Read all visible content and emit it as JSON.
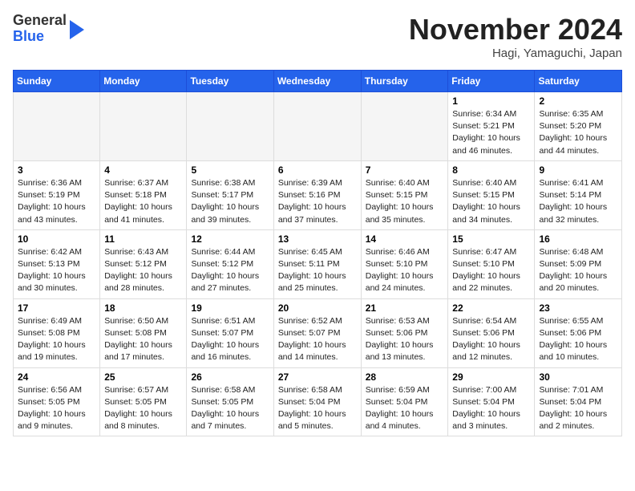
{
  "header": {
    "logo_line1": "General",
    "logo_line2": "Blue",
    "month": "November 2024",
    "location": "Hagi, Yamaguchi, Japan"
  },
  "weekdays": [
    "Sunday",
    "Monday",
    "Tuesday",
    "Wednesday",
    "Thursday",
    "Friday",
    "Saturday"
  ],
  "weeks": [
    [
      {
        "day": "",
        "info": ""
      },
      {
        "day": "",
        "info": ""
      },
      {
        "day": "",
        "info": ""
      },
      {
        "day": "",
        "info": ""
      },
      {
        "day": "",
        "info": ""
      },
      {
        "day": "1",
        "info": "Sunrise: 6:34 AM\nSunset: 5:21 PM\nDaylight: 10 hours\nand 46 minutes."
      },
      {
        "day": "2",
        "info": "Sunrise: 6:35 AM\nSunset: 5:20 PM\nDaylight: 10 hours\nand 44 minutes."
      }
    ],
    [
      {
        "day": "3",
        "info": "Sunrise: 6:36 AM\nSunset: 5:19 PM\nDaylight: 10 hours\nand 43 minutes."
      },
      {
        "day": "4",
        "info": "Sunrise: 6:37 AM\nSunset: 5:18 PM\nDaylight: 10 hours\nand 41 minutes."
      },
      {
        "day": "5",
        "info": "Sunrise: 6:38 AM\nSunset: 5:17 PM\nDaylight: 10 hours\nand 39 minutes."
      },
      {
        "day": "6",
        "info": "Sunrise: 6:39 AM\nSunset: 5:16 PM\nDaylight: 10 hours\nand 37 minutes."
      },
      {
        "day": "7",
        "info": "Sunrise: 6:40 AM\nSunset: 5:15 PM\nDaylight: 10 hours\nand 35 minutes."
      },
      {
        "day": "8",
        "info": "Sunrise: 6:40 AM\nSunset: 5:15 PM\nDaylight: 10 hours\nand 34 minutes."
      },
      {
        "day": "9",
        "info": "Sunrise: 6:41 AM\nSunset: 5:14 PM\nDaylight: 10 hours\nand 32 minutes."
      }
    ],
    [
      {
        "day": "10",
        "info": "Sunrise: 6:42 AM\nSunset: 5:13 PM\nDaylight: 10 hours\nand 30 minutes."
      },
      {
        "day": "11",
        "info": "Sunrise: 6:43 AM\nSunset: 5:12 PM\nDaylight: 10 hours\nand 28 minutes."
      },
      {
        "day": "12",
        "info": "Sunrise: 6:44 AM\nSunset: 5:12 PM\nDaylight: 10 hours\nand 27 minutes."
      },
      {
        "day": "13",
        "info": "Sunrise: 6:45 AM\nSunset: 5:11 PM\nDaylight: 10 hours\nand 25 minutes."
      },
      {
        "day": "14",
        "info": "Sunrise: 6:46 AM\nSunset: 5:10 PM\nDaylight: 10 hours\nand 24 minutes."
      },
      {
        "day": "15",
        "info": "Sunrise: 6:47 AM\nSunset: 5:10 PM\nDaylight: 10 hours\nand 22 minutes."
      },
      {
        "day": "16",
        "info": "Sunrise: 6:48 AM\nSunset: 5:09 PM\nDaylight: 10 hours\nand 20 minutes."
      }
    ],
    [
      {
        "day": "17",
        "info": "Sunrise: 6:49 AM\nSunset: 5:08 PM\nDaylight: 10 hours\nand 19 minutes."
      },
      {
        "day": "18",
        "info": "Sunrise: 6:50 AM\nSunset: 5:08 PM\nDaylight: 10 hours\nand 17 minutes."
      },
      {
        "day": "19",
        "info": "Sunrise: 6:51 AM\nSunset: 5:07 PM\nDaylight: 10 hours\nand 16 minutes."
      },
      {
        "day": "20",
        "info": "Sunrise: 6:52 AM\nSunset: 5:07 PM\nDaylight: 10 hours\nand 14 minutes."
      },
      {
        "day": "21",
        "info": "Sunrise: 6:53 AM\nSunset: 5:06 PM\nDaylight: 10 hours\nand 13 minutes."
      },
      {
        "day": "22",
        "info": "Sunrise: 6:54 AM\nSunset: 5:06 PM\nDaylight: 10 hours\nand 12 minutes."
      },
      {
        "day": "23",
        "info": "Sunrise: 6:55 AM\nSunset: 5:06 PM\nDaylight: 10 hours\nand 10 minutes."
      }
    ],
    [
      {
        "day": "24",
        "info": "Sunrise: 6:56 AM\nSunset: 5:05 PM\nDaylight: 10 hours\nand 9 minutes."
      },
      {
        "day": "25",
        "info": "Sunrise: 6:57 AM\nSunset: 5:05 PM\nDaylight: 10 hours\nand 8 minutes."
      },
      {
        "day": "26",
        "info": "Sunrise: 6:58 AM\nSunset: 5:05 PM\nDaylight: 10 hours\nand 7 minutes."
      },
      {
        "day": "27",
        "info": "Sunrise: 6:58 AM\nSunset: 5:04 PM\nDaylight: 10 hours\nand 5 minutes."
      },
      {
        "day": "28",
        "info": "Sunrise: 6:59 AM\nSunset: 5:04 PM\nDaylight: 10 hours\nand 4 minutes."
      },
      {
        "day": "29",
        "info": "Sunrise: 7:00 AM\nSunset: 5:04 PM\nDaylight: 10 hours\nand 3 minutes."
      },
      {
        "day": "30",
        "info": "Sunrise: 7:01 AM\nSunset: 5:04 PM\nDaylight: 10 hours\nand 2 minutes."
      }
    ]
  ]
}
